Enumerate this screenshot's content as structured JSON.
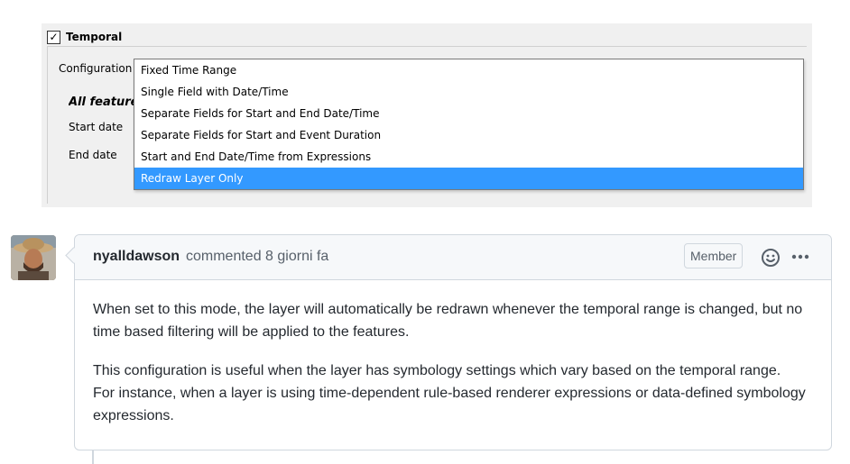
{
  "qgis": {
    "group_title": "Temporal",
    "checkbox_mark": "✓",
    "config_label": "Configuration",
    "all_features_label": "All features",
    "start_date_label": "Start date",
    "end_date_label": "End date",
    "dropdown_options": [
      "Fixed Time Range",
      "Single Field with Date/Time",
      "Separate Fields for Start and End Date/Time",
      "Separate Fields for Start and Event Duration",
      "Start and End Date/Time from Expressions",
      "Redraw Layer Only"
    ],
    "selected_option": "Redraw Layer Only",
    "selection_color": "#3399ff"
  },
  "comment": {
    "author": "nyalldawson",
    "action": "commented 8 giorni fa",
    "badge": "Member",
    "paragraphs": [
      "When set to this mode, the layer will automatically be redrawn whenever the temporal range is changed, but no time based filtering will be applied to the features.",
      "This configuration is useful when the layer has symbology settings which vary based on the temporal range. For instance, when a layer is using time-dependent rule-based renderer expressions or data-defined symbology expressions."
    ],
    "icons": [
      "smiley-icon",
      "more-options-icon"
    ]
  }
}
